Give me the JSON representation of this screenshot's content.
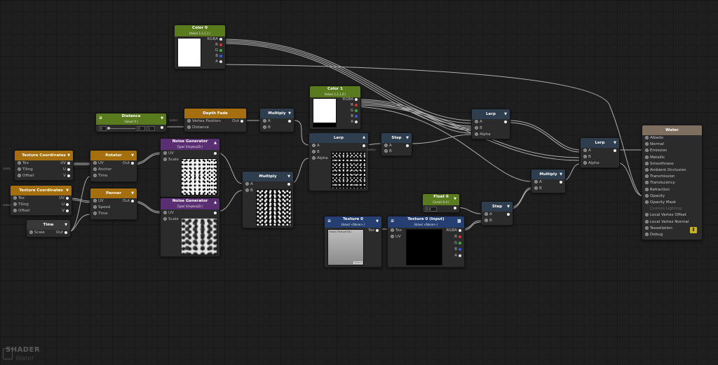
{
  "branding": {
    "logo": "SHADER",
    "shader_name": "Water"
  },
  "labels": {
    "out": "Out",
    "uv": "UV",
    "tex": "Tex",
    "tiling": "Tiling",
    "offset": "Offset",
    "scale": "Scale",
    "a": "A",
    "b": "B",
    "alpha": "Alpha",
    "anchor": "Anchor",
    "time": "Time",
    "speed": "Speed",
    "rgba": "RGBA",
    "r": "R",
    "g": "G",
    "bch": "B",
    "ach": "A",
    "u": "U",
    "v": "V",
    "vertex_position": "Vertex Position",
    "distance": "Distance",
    "input_tag": "EDEE0",
    "none_sub": "Value( <None> )"
  },
  "nodes": {
    "color0": {
      "title": "Color 0",
      "subtitle": "Value( 1,1,1,1 )"
    },
    "color1": {
      "title": "Color 1",
      "subtitle": "Value( 1,1,1,0 )"
    },
    "distance": {
      "title": "Distance",
      "subtitle": "Value( 0 )",
      "field_min": "0",
      "field_a": "0",
      "field_b": "1"
    },
    "depthfade": {
      "title": "Depth Fade"
    },
    "multiply1": {
      "title": "Multiply"
    },
    "multiply2": {
      "title": "Multiply"
    },
    "multiply3": {
      "title": "Multiply"
    },
    "lerp1": {
      "title": "Lerp"
    },
    "lerp2": {
      "title": "Lerp"
    },
    "lerp3": {
      "title": "Lerp"
    },
    "step1": {
      "title": "Step"
    },
    "step2": {
      "title": "Step"
    },
    "texcoord1": {
      "title": "Texture Coordinates"
    },
    "texcoord2": {
      "title": "Texture Coordinates"
    },
    "rotator": {
      "title": "Rotator"
    },
    "panner": {
      "title": "Panner"
    },
    "time": {
      "title": "Time"
    },
    "noise1": {
      "title": "Noise Generator",
      "subtitle": "Type( Simplex2D )"
    },
    "noise2": {
      "title": "Noise Generator",
      "subtitle": "Type( Simplex2D )"
    },
    "float0": {
      "title": "Float 0",
      "subtitle": "Const( 0.4 )",
      "value": "0.4"
    },
    "texture0": {
      "title": "Texture 0",
      "subtitle": "Value( <None> )",
      "preview_label": "None (Texture2D)",
      "select": "Select"
    },
    "texture0input": {
      "title": "Texture 0 (Input)",
      "subtitle": "Value( <None> )"
    },
    "water": {
      "title": "Water",
      "inputs": [
        "Albedo",
        "Normal",
        "Emission",
        "Metallic",
        "Smoothness",
        "Ambient Occlusion",
        "Transmission",
        "Translucency",
        "Refraction",
        "Opacity",
        "Opacity Mask",
        "Custom Lighting",
        "Local Vertex Offset",
        "Local Vertex Normal",
        "Tessellation",
        "Debug"
      ]
    }
  },
  "colors": {
    "green": "#5a7a1e",
    "gold": "#a56f0f",
    "blue": "#253f72",
    "purple": "#5a2e72",
    "slate": "#2f3e4f",
    "selection": "#c7b21f"
  }
}
